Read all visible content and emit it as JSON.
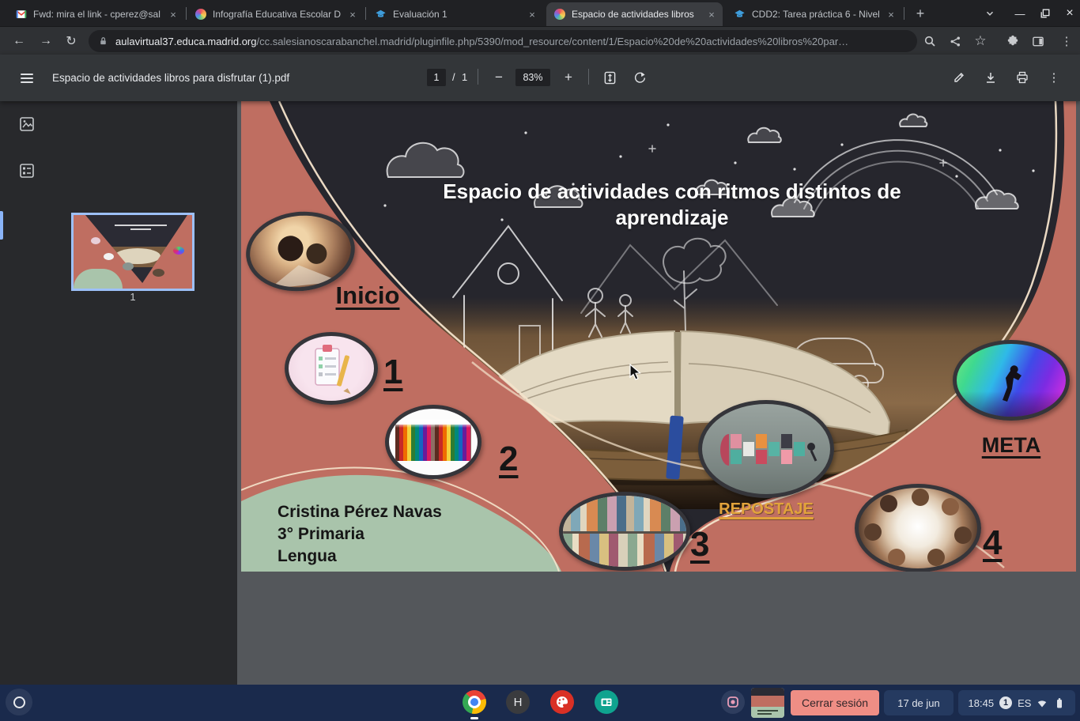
{
  "browser": {
    "tabs": [
      {
        "title": "Fwd: mira el link - cperez@sal",
        "icon": "gmail-icon"
      },
      {
        "title": "Infografía Educativa Escolar D",
        "icon": "genially-icon"
      },
      {
        "title": "Evaluación 1",
        "icon": "campus-icon"
      },
      {
        "title": "Espacio de actividades libros",
        "icon": "genially-icon"
      },
      {
        "title": "CDD2: Tarea práctica 6 - Nivel",
        "icon": "campus-icon"
      }
    ],
    "url": {
      "domain": "aulavirtual37.educa.madrid.org",
      "path": "/cc.salesianoscarabanchel.madrid/pluginfile.php/5390/mod_resource/content/1/Espacio%20de%20actividades%20libros%20par…"
    }
  },
  "pdf": {
    "title": "Espacio de actividades libros para disfrutar (1).pdf",
    "page_current": "1",
    "page_separator": "/",
    "page_total": "1",
    "zoom": "83%",
    "thumbnail_page": "1"
  },
  "slide": {
    "title": "Espacio de actividades con ritmos distintos de aprendizaje",
    "inicio": "Inicio",
    "step1": "1",
    "step2": "2",
    "step3": "3",
    "step4": "4",
    "repostaje": "REPOSTAJE",
    "meta": "META",
    "author": "Cristina Pérez Navas",
    "grade": "3° Primaria",
    "subject": "Lengua"
  },
  "shelf": {
    "logout": "Cerrar sesión",
    "date": "17 de jun",
    "time": "18:45",
    "notifications": "1",
    "lang": "ES",
    "app_h": "H"
  },
  "glyphs": {
    "back": "←",
    "forward": "→",
    "reload": "↻",
    "minus": "−",
    "plus": "+",
    "dots": "⋮",
    "close": "×",
    "star": "☆",
    "add_tab": "+",
    "minimize": "—"
  },
  "colors": {
    "salmon_path": "#bf6e61",
    "green_blob": "#a9c4ab",
    "shelf_navy": "#1a2a4c",
    "accent_blue": "#8ab4f8",
    "repostaje_text": "#e2a33b",
    "logout_button": "#ef8e85"
  }
}
